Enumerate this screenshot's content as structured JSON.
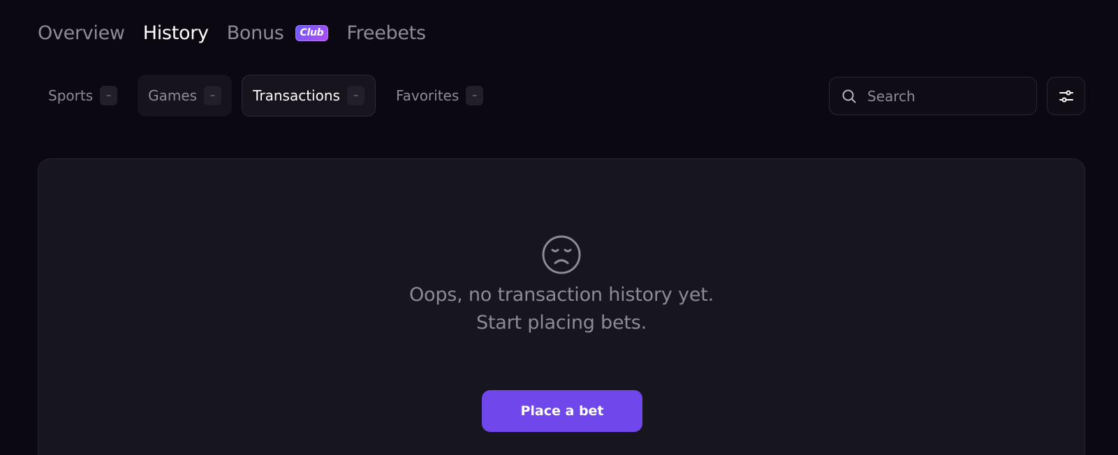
{
  "top_tabs": [
    {
      "label": "Overview",
      "active": false
    },
    {
      "label": "History",
      "active": true
    },
    {
      "label": "Bonus",
      "badge": "Club",
      "active": false
    },
    {
      "label": "Freebets",
      "active": false
    }
  ],
  "filter_tabs": [
    {
      "label": "Sports",
      "count": "–"
    },
    {
      "label": "Games",
      "count": "–"
    },
    {
      "label": "Transactions",
      "count": "–",
      "active": true
    },
    {
      "label": "Favorites",
      "count": "–"
    }
  ],
  "search": {
    "placeholder": "Search",
    "value": ""
  },
  "icons": {
    "search": "search-icon",
    "filter": "sliders-icon",
    "empty": "sad-face-icon"
  },
  "empty_state": {
    "line1": "Oops, no transaction history yet.",
    "line2": "Start placing bets."
  },
  "cta": {
    "label": "Place a bet"
  },
  "colors": {
    "background": "#0c0812",
    "accent": "#7047ea",
    "badge_gradient_start": "#6a5cff",
    "badge_gradient_end": "#b24bf3",
    "muted_text": "#8f8b96"
  }
}
